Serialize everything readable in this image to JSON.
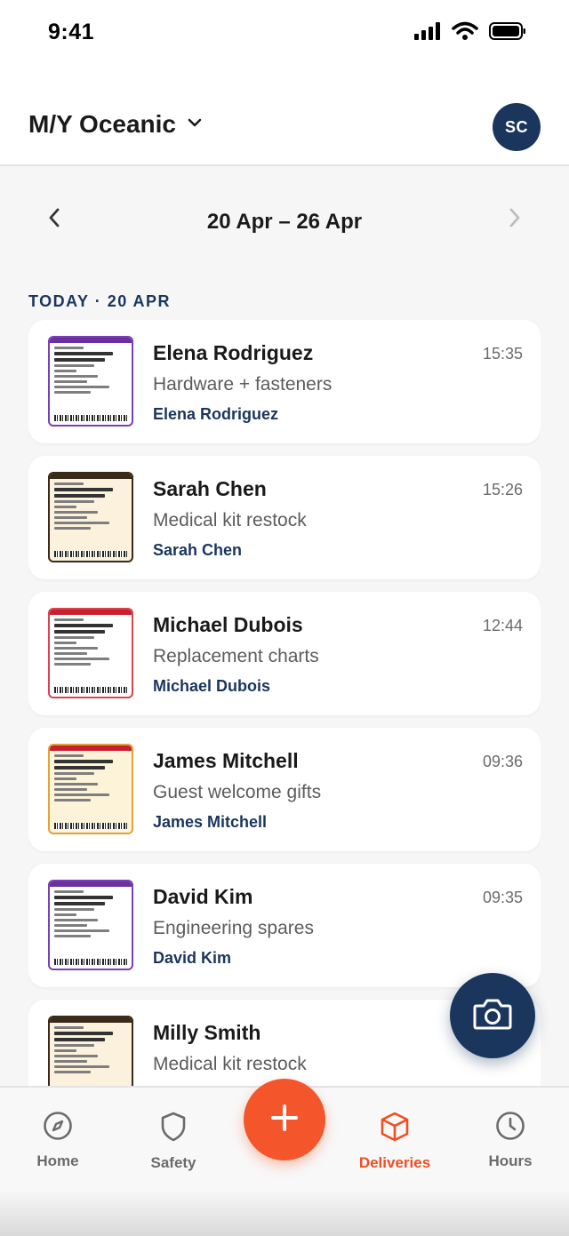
{
  "status": {
    "time": "9:41",
    "icons": [
      "cellular-signal-icon",
      "wifi-icon",
      "battery-icon"
    ]
  },
  "header": {
    "vessel_name": "M/Y Oceanic",
    "avatar_initials": "SC"
  },
  "week": {
    "label": "20 Apr – 26 Apr"
  },
  "section": {
    "title": "TODAY · 20 APR"
  },
  "deliveries": [
    {
      "name": "Elena Rodriguez",
      "time": "15:35",
      "description": "Hardware + fasteners",
      "recipient": "Elena Rodriguez",
      "label_color": "#7a3fb3",
      "band_color": "#6b2fa0",
      "paper": "#ffffff"
    },
    {
      "name": "Sarah Chen",
      "time": "15:26",
      "description": "Medical kit restock",
      "recipient": "Sarah Chen",
      "label_color": "#3a2a1a",
      "band_color": "#3a2a1a",
      "paper": "#fbf1dc"
    },
    {
      "name": "Michael Dubois",
      "time": "12:44",
      "description": "Replacement charts",
      "recipient": "Michael Dubois",
      "label_color": "#d9434f",
      "band_color": "#c8202e",
      "paper": "#ffffff"
    },
    {
      "name": "James Mitchell",
      "time": "09:36",
      "description": "Guest welcome gifts",
      "recipient": "James Mitchell",
      "label_color": "#e0a33a",
      "band_color": "#c8202e",
      "paper": "#fdf3d8"
    },
    {
      "name": "David Kim",
      "time": "09:35",
      "description": "Engineering spares",
      "recipient": "David Kim",
      "label_color": "#7a3fb3",
      "band_color": "#6b2fa0",
      "paper": "#ffffff"
    },
    {
      "name": "Milly Smith",
      "time": "",
      "description": "Medical kit restock",
      "recipient": "",
      "label_color": "#3a2a1a",
      "band_color": "#3a2a1a",
      "paper": "#fbf1dc"
    }
  ],
  "tabs": [
    {
      "label": "Home",
      "icon": "compass-icon",
      "active": false
    },
    {
      "label": "Safety",
      "icon": "shield-icon",
      "active": false
    },
    {
      "label": "Deliveries",
      "icon": "box-icon",
      "active": true
    },
    {
      "label": "Hours",
      "icon": "clock-icon",
      "active": false
    }
  ],
  "colors": {
    "primary": "#1b365d",
    "accent": "#f4552b",
    "active_tab": "#f04e23"
  }
}
